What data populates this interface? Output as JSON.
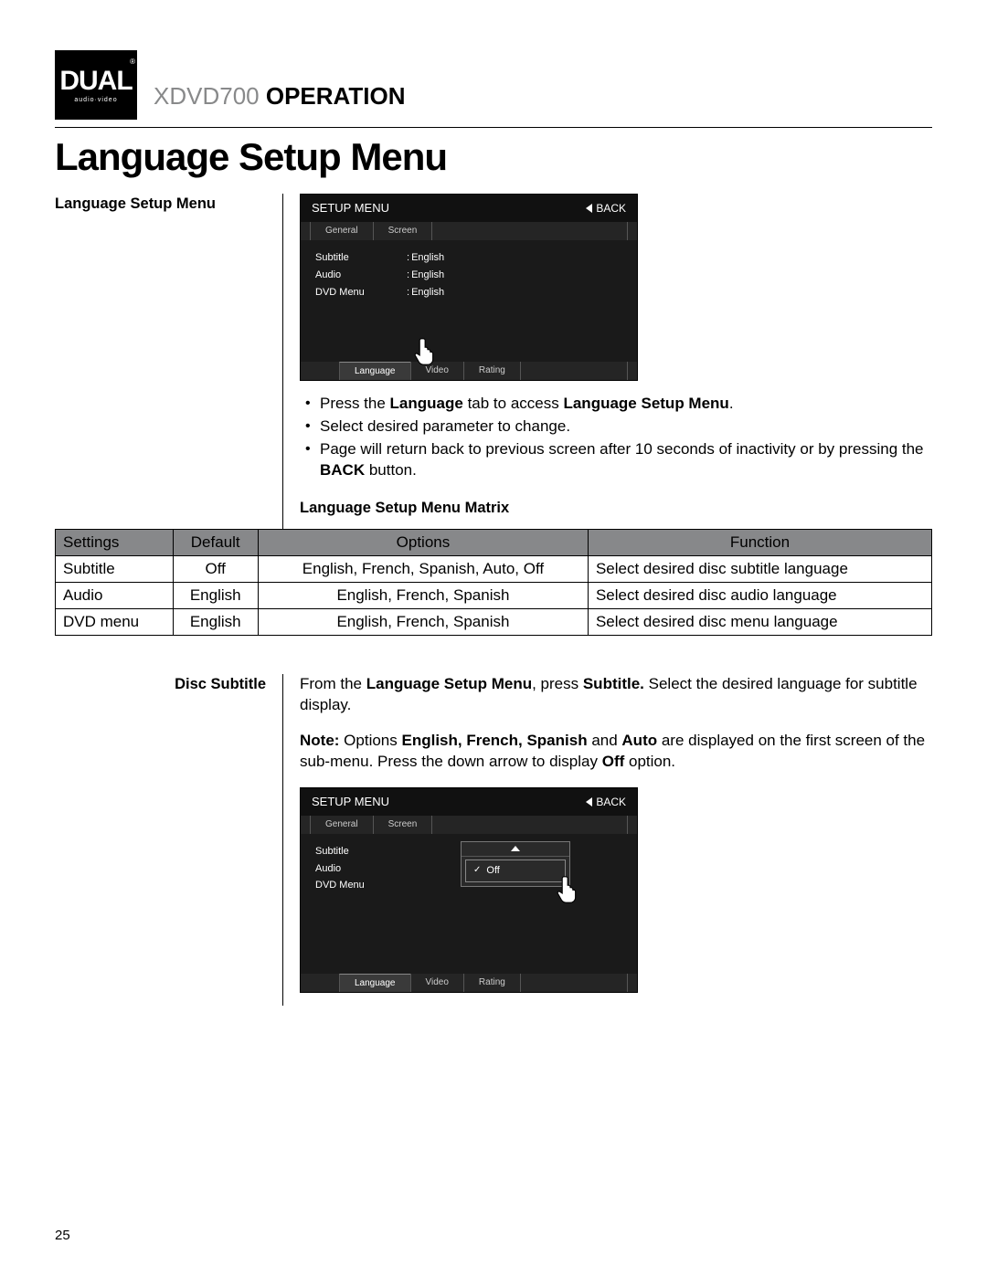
{
  "logo": {
    "brand": "DUAL",
    "sub": "audio·video",
    "reg": "®"
  },
  "header": {
    "model": "XDVD700",
    "section": "OPERATION"
  },
  "page_title": "Language Setup Menu",
  "section1": {
    "label": "Language Setup Menu",
    "osd": {
      "title": "SETUP MENU",
      "back": "BACK",
      "top_tabs": [
        "General",
        "Screen"
      ],
      "bottom_tabs": [
        "Language",
        "Video",
        "Rating"
      ],
      "selected_bottom": "Language",
      "rows": [
        {
          "k": "Subtitle",
          "v": "English"
        },
        {
          "k": "Audio",
          "v": "English"
        },
        {
          "k": "DVD Menu",
          "v": "English"
        }
      ]
    },
    "bullets": [
      [
        {
          "t": "Press the "
        },
        {
          "t": "Language",
          "b": true
        },
        {
          "t": " tab to access "
        },
        {
          "t": "Language Setup Menu",
          "b": true
        },
        {
          "t": "."
        }
      ],
      [
        {
          "t": "Select desired parameter to change."
        }
      ],
      [
        {
          "t": "Page will return back to previous screen after 10 seconds of inactivity or by pressing the "
        },
        {
          "t": "BACK",
          "b": true
        },
        {
          "t": " button."
        }
      ]
    ],
    "matrix_title": "Language Setup Menu Matrix"
  },
  "matrix": {
    "headers": [
      "Settings",
      "Default",
      "Options",
      "Function"
    ],
    "rows": [
      [
        "Subtitle",
        "Off",
        "English, French, Spanish, Auto, Off",
        "Select desired disc subtitle language"
      ],
      [
        "Audio",
        "English",
        "English, French, Spanish",
        "Select desired disc audio language"
      ],
      [
        "DVD menu",
        "English",
        "English, French, Spanish",
        "Select desired disc menu language"
      ]
    ]
  },
  "section2": {
    "label": "Disc Subtitle",
    "para1": [
      {
        "t": "From the "
      },
      {
        "t": "Language Setup Menu",
        "b": true
      },
      {
        "t": ", press "
      },
      {
        "t": "Subtitle.",
        "b": true
      },
      {
        "t": " Select the desired language for subtitle display."
      }
    ],
    "para2": [
      {
        "t": "Note:",
        "b": true
      },
      {
        "t": " Options "
      },
      {
        "t": "English, French, Spanish",
        "b": true
      },
      {
        "t": " and "
      },
      {
        "t": "Auto",
        "b": true
      },
      {
        "t": " are displayed on the first screen of the sub-menu. Press the down arrow to display "
      },
      {
        "t": "Off",
        "b": true
      },
      {
        "t": " option."
      }
    ],
    "osd": {
      "title": "SETUP MENU",
      "back": "BACK",
      "top_tabs": [
        "General",
        "Screen"
      ],
      "bottom_tabs": [
        "Language",
        "Video",
        "Rating"
      ],
      "selected_bottom": "Language",
      "rows": [
        {
          "k": "Subtitle"
        },
        {
          "k": "Audio"
        },
        {
          "k": "DVD Menu"
        }
      ],
      "popup_option": "Off"
    }
  },
  "page_number": "25"
}
